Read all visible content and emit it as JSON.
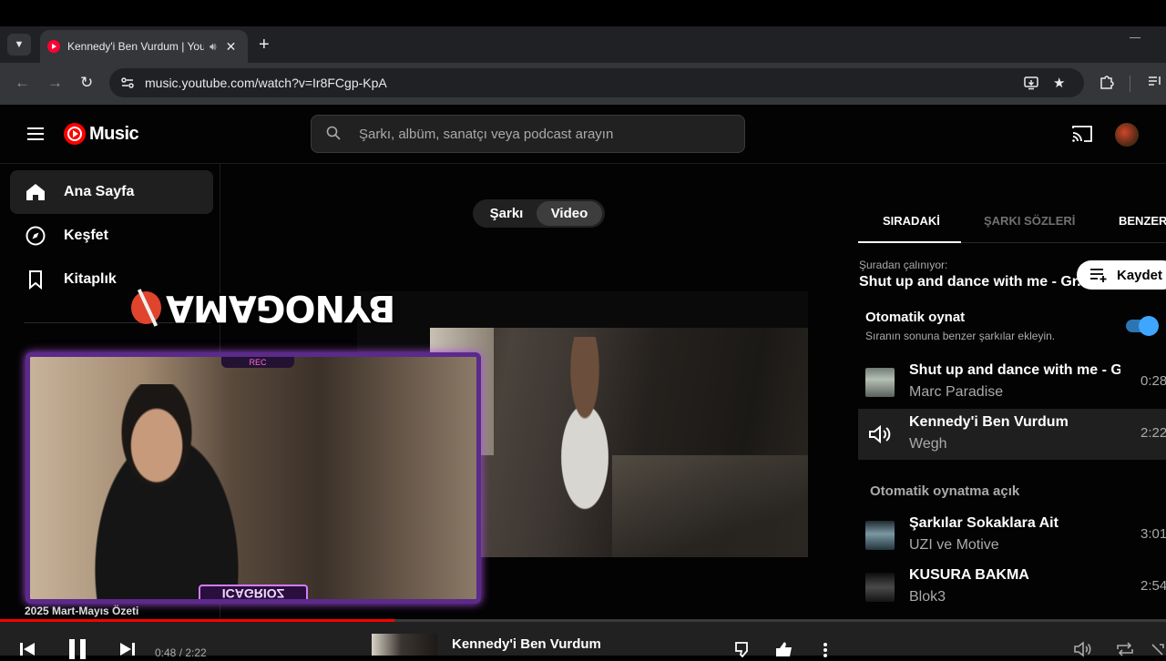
{
  "browser": {
    "tab_title": "Kennedy'i Ben Vurdum | YouTube Music",
    "tab_list_icon": "chevron-down-icon",
    "new_tab_label": "+",
    "url": "music.youtube.com/watch?v=Ir8FCgp-KpA"
  },
  "header": {
    "logo_text": "Music",
    "search_placeholder": "Şarkı, albüm, sanatçı veya podcast arayın"
  },
  "sidebar": {
    "items": [
      {
        "label": "Ana Sayfa",
        "icon": "home-icon",
        "active": true
      },
      {
        "label": "Keşfet",
        "icon": "compass-icon",
        "active": false
      },
      {
        "label": "Kitaplık",
        "icon": "bookmark-icon",
        "active": false
      }
    ],
    "partial_item": "2025 Mart-Mayıs Özeti"
  },
  "player": {
    "toggle": {
      "song": "Şarkı",
      "video": "Video",
      "selected": "video"
    },
    "overlay": {
      "brand_text": "BYNOGAMA",
      "rec_text": "REC",
      "streamer_name": "ICAGRIOZ"
    }
  },
  "panel": {
    "tabs": [
      "SIRADAKİ",
      "ŞARKI SÖZLERİ",
      "BENZER"
    ],
    "active_tab": 0,
    "playing_from_label": "Şuradan çalınıyor:",
    "playlist_name": "Shut up and dance with me - Gr...",
    "save_label": "Kaydet",
    "autoplay_title": "Otomatik oynat",
    "autoplay_subtitle": "Sıranın sonuna benzer şarkılar ekleyin.",
    "autoplay_enabled": true,
    "queue": [
      {
        "title": "Shut up and dance with me - G...",
        "artist": "Marc Paradise",
        "duration": "0:28",
        "current": false
      },
      {
        "title": "Kennedy'i Ben Vurdum",
        "artist": "Wegh",
        "duration": "2:22",
        "current": true
      }
    ],
    "autoplay_on_label": "Otomatik oynatma açık",
    "autoplay_queue": [
      {
        "title": "Şarkılar Sokaklara Ait",
        "artist": "UZI ve Motive",
        "duration": "3:01"
      },
      {
        "title": "KUSURA BAKMA",
        "artist": "Blok3",
        "duration": "2:54"
      }
    ]
  },
  "playerbar": {
    "time": "0:48 / 2:22",
    "progress_fraction": 0.338,
    "title": "Kennedy'i Ben Vurdum"
  },
  "colors": {
    "accent_red": "#ff0000",
    "toggle_blue": "#3ea6ff",
    "background": "#030303"
  }
}
